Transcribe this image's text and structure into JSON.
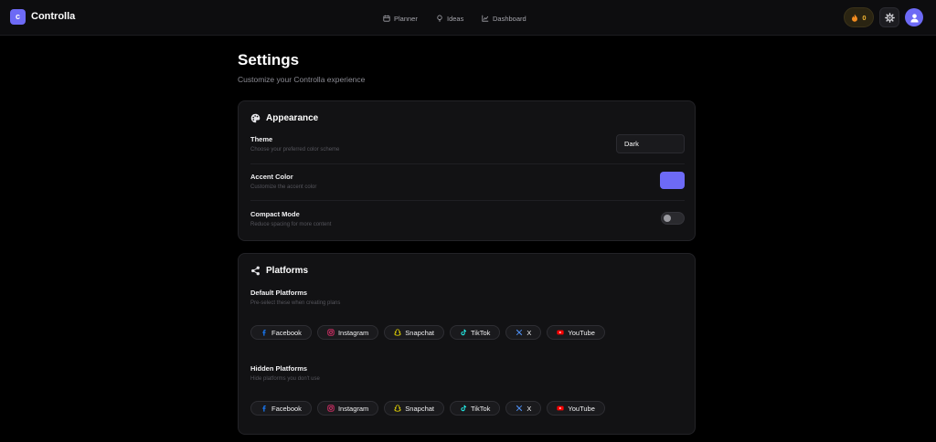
{
  "app": {
    "logo_letter": "c",
    "brand": "Controlla"
  },
  "nav": {
    "planner": "Planner",
    "ideas": "Ideas",
    "dashboard": "Dashboard"
  },
  "header": {
    "streak_count": "0"
  },
  "page": {
    "title": "Settings",
    "subtitle": "Customize your Controlla experience"
  },
  "appearance": {
    "title": "Appearance",
    "theme": {
      "label": "Theme",
      "desc": "Choose your preferred color scheme",
      "value": "Dark"
    },
    "accent": {
      "label": "Accent Color",
      "desc": "Customize the accent color",
      "color": "#6d6af5"
    },
    "compact": {
      "label": "Compact Mode",
      "desc": "Reduce spacing for more content",
      "enabled": false
    }
  },
  "platforms": {
    "title": "Platforms",
    "default": {
      "label": "Default Platforms",
      "desc": "Pre-select these when creating plans",
      "items": [
        "Facebook",
        "Instagram",
        "Snapchat",
        "TikTok",
        "X",
        "YouTube"
      ]
    },
    "hidden": {
      "label": "Hidden Platforms",
      "desc": "Hide platforms you don't use",
      "items": [
        "Facebook",
        "Instagram",
        "Snapchat",
        "TikTok",
        "X",
        "YouTube"
      ]
    }
  },
  "icons": {
    "planner": "calendar-icon",
    "ideas": "lightbulb-icon",
    "dashboard": "chart-line-icon",
    "streak": "flame-icon",
    "settings": "gear-icon",
    "avatar": "user-icon",
    "appearance": "palette-icon",
    "platforms": "share-icon"
  },
  "colors": {
    "accent": "#6d6af5",
    "streak": "#f5b731",
    "facebook": "#1877f2",
    "instagram": "#e1306c",
    "snapchat": "#f7e400",
    "tiktok": "#25f4ee",
    "x": "#4d8ef0",
    "youtube": "#ff0000"
  }
}
